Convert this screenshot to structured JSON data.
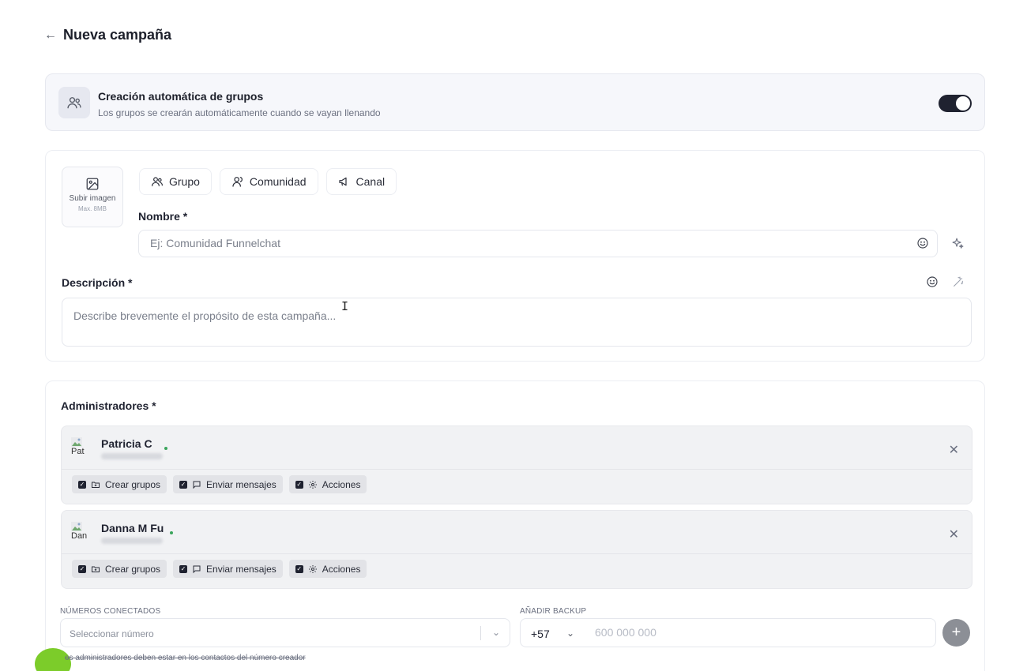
{
  "header": {
    "back_icon": "arrow-left-icon",
    "title": "Nueva campaña"
  },
  "auto_groups": {
    "icon": "users-icon",
    "title": "Creación automática de grupos",
    "subtitle": "Los grupos se crearán automáticamente cuando se vayan llenando",
    "toggle_on": true
  },
  "campaign": {
    "upload": {
      "label": "Subir imagen",
      "max": "Max. 8MB"
    },
    "tabs": [
      {
        "label": "Grupo",
        "icon": "users-icon"
      },
      {
        "label": "Comunidad",
        "icon": "community-icon"
      },
      {
        "label": "Canal",
        "icon": "megaphone-icon"
      }
    ],
    "name": {
      "label": "Nombre *",
      "placeholder": "Ej: Comunidad Funnelchat"
    },
    "description": {
      "label": "Descripción *",
      "placeholder": "Describe brevemente el propósito de esta campaña..."
    }
  },
  "admins": {
    "label": "Administradores *",
    "items": [
      {
        "name": "Patricia C",
        "avatar_alt": "Pat",
        "permissions": [
          "Crear grupos",
          "Enviar mensajes",
          "Acciones"
        ]
      },
      {
        "name": "Danna M Fu",
        "avatar_alt": "Dan",
        "permissions": [
          "Crear grupos",
          "Enviar mensajes",
          "Acciones"
        ]
      }
    ]
  },
  "connected": {
    "label": "NÚMEROS CONECTADOS",
    "placeholder": "Seleccionar número"
  },
  "backup": {
    "label": "AÑADIR BACKUP",
    "country_code": "+57",
    "placeholder": "600 000 000"
  },
  "note": "os administradores deben estar en los contactos del número creador",
  "colors": {
    "toggle": "#1f2230",
    "add_button": "#8c8f96",
    "online": "#3aa55c"
  }
}
